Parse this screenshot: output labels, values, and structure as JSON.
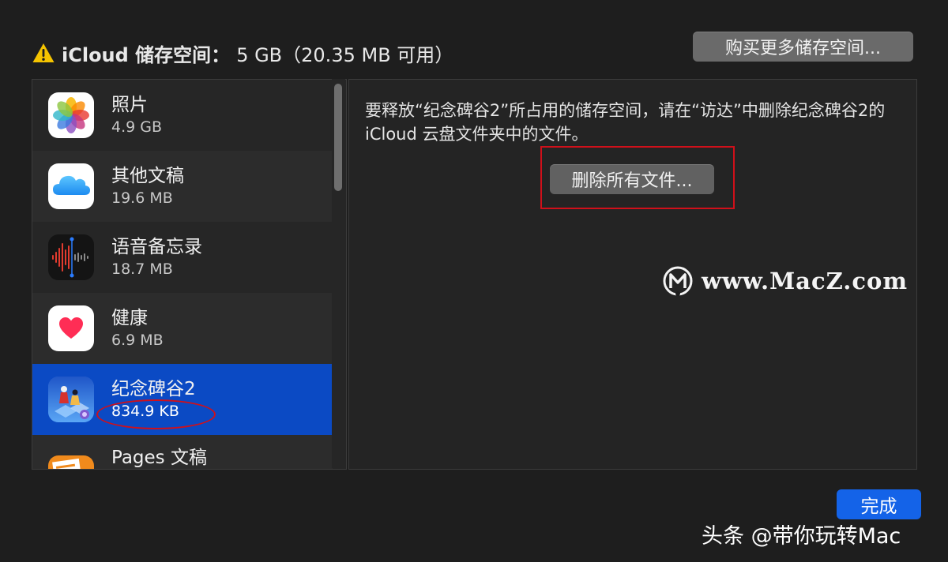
{
  "header": {
    "title": "iCloud 储存空间：",
    "storage": "5  GB（20.35  MB 可用）"
  },
  "buy_button": "购买更多储存空间...",
  "apps": [
    {
      "name": "照片",
      "size": "4.9  GB",
      "icon": "photos-icon"
    },
    {
      "name": "其他文稿",
      "size": "19.6  MB",
      "icon": "icloud-drive-icon"
    },
    {
      "name": "语音备忘录",
      "size": "18.7  MB",
      "icon": "voice-memos-icon"
    },
    {
      "name": "健康",
      "size": "6.9  MB",
      "icon": "health-icon"
    },
    {
      "name": "纪念碑谷2",
      "size": "834.9  KB",
      "icon": "monument-valley-icon",
      "selected": true
    },
    {
      "name": "Pages 文稿",
      "size": "",
      "icon": "pages-icon"
    }
  ],
  "detail": {
    "description": "要释放“纪念碑谷2”所占用的储存空间，请在“访达”中删除纪念碑谷2的 iCloud 云盘文件夹中的文件。",
    "delete_button": "删除所有文件..."
  },
  "watermark": "www.MacZ.com",
  "done_button": "完成",
  "credit": "头条 @带你玩转Mac",
  "colors": {
    "selection": "#0b4ac4",
    "primary_button": "#1463e8",
    "annotation": "#d0101a"
  }
}
